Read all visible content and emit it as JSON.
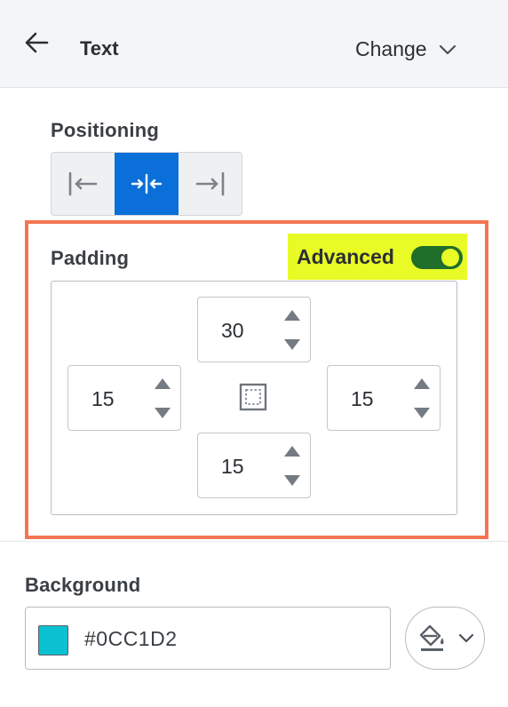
{
  "header": {
    "title": "Text",
    "change_label": "Change"
  },
  "positioning": {
    "label": "Positioning",
    "options": [
      "align-left-icon",
      "align-center-icon",
      "align-right-icon"
    ],
    "active": "align-center-icon"
  },
  "padding": {
    "label": "Padding",
    "advanced_label": "Advanced",
    "advanced_enabled": true,
    "top": "30",
    "left": "15",
    "right": "15",
    "bottom": "15"
  },
  "background": {
    "label": "Background",
    "color_value": "#0CC1D2",
    "swatch_color": "#0CC1D2"
  },
  "colors": {
    "accent_blue": "#0a6fd8",
    "toggle_green": "#1f6e2a",
    "highlight_yellow": "#e8fb26",
    "highlight_border": "#f47553"
  }
}
